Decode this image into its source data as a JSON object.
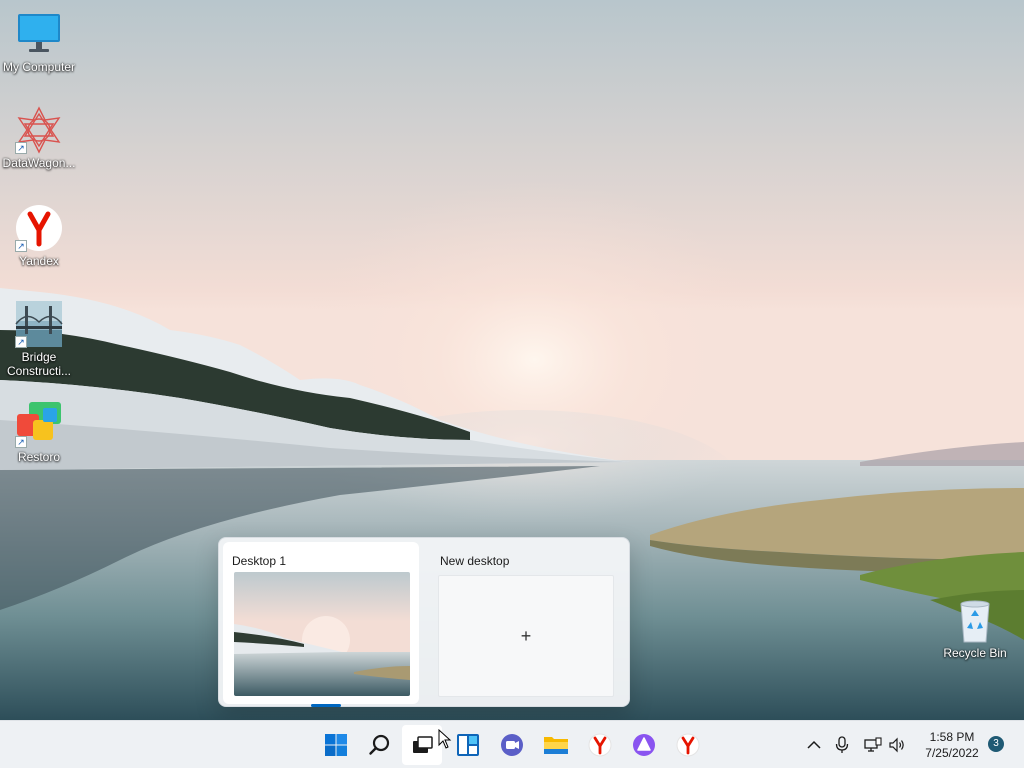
{
  "desktop": {
    "icons": [
      {
        "label": "My Computer",
        "icon": "monitor-icon"
      },
      {
        "label": "DataWagon...",
        "icon": "datawagon-icon"
      },
      {
        "label": "Yandex",
        "icon": "yandex-icon"
      },
      {
        "label": "Bridge Constructi...",
        "icon": "bridge-construction-icon"
      },
      {
        "label": "Restoro",
        "icon": "restoro-icon"
      },
      {
        "label": "Recycle Bin",
        "icon": "recycle-bin-icon"
      }
    ]
  },
  "task_view": {
    "desktops": [
      {
        "label": "Desktop 1",
        "active": true
      },
      {
        "label": "New desktop",
        "action_symbol": "+"
      }
    ]
  },
  "taskbar": {
    "pinned": [
      {
        "name": "Start",
        "icon": "windows-start-icon"
      },
      {
        "name": "Search",
        "icon": "search-icon"
      },
      {
        "name": "Task View",
        "icon": "task-view-icon"
      },
      {
        "name": "Widgets",
        "icon": "widgets-icon"
      },
      {
        "name": "Chat",
        "icon": "chat-icon"
      },
      {
        "name": "File Explorer",
        "icon": "file-explorer-icon"
      },
      {
        "name": "Yandex Browser",
        "icon": "yandex-icon"
      },
      {
        "name": "Alice",
        "icon": "alice-icon"
      },
      {
        "name": "Yandex",
        "icon": "yandex-icon"
      }
    ],
    "tray": {
      "icons": [
        "chevron-up-icon",
        "microphone-icon",
        "network-icon",
        "volume-icon"
      ],
      "time": "1:58 PM",
      "date": "7/25/2022",
      "notification_count": "3"
    }
  },
  "colors": {
    "accent": "#0067c0",
    "taskbar_bg": "#eef1f4",
    "yandex_red": "#e61400",
    "alice_purple": "#8a54f0"
  }
}
